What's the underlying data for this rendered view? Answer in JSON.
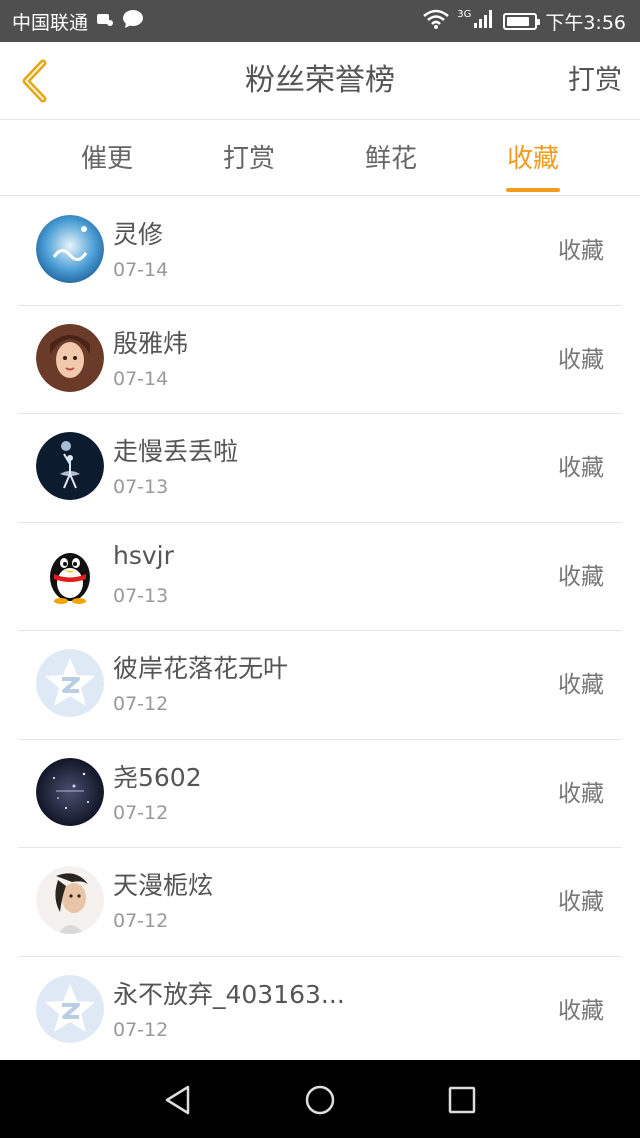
{
  "status_bar": {
    "carrier": "中国联通",
    "network": "3G",
    "time": "下午3:56",
    "battery_level": 0.85
  },
  "header": {
    "title": "粉丝荣誉榜",
    "right_action": "打赏"
  },
  "tabs": [
    {
      "label": "催更",
      "active": false
    },
    {
      "label": "打赏",
      "active": false
    },
    {
      "label": "鲜花",
      "active": false
    },
    {
      "label": "收藏",
      "active": true
    }
  ],
  "colors": {
    "accent": "#f29b1d",
    "status_bar_bg": "#4f4f4f"
  },
  "fans": [
    {
      "name": "灵修",
      "date": "07-14",
      "action": "收藏",
      "avatar": "blue-watercolor-avatar"
    },
    {
      "name": "殷雅炜",
      "date": "07-14",
      "action": "收藏",
      "avatar": "girl-portrait-avatar"
    },
    {
      "name": "走慢丢丢啦",
      "date": "07-13",
      "action": "收藏",
      "avatar": "dancer-night-avatar"
    },
    {
      "name": "hsvjr",
      "date": "07-13",
      "action": "收藏",
      "avatar": "penguin-avatar"
    },
    {
      "name": "彼岸花落花无叶",
      "date": "07-12",
      "action": "收藏",
      "avatar": "default-star-avatar"
    },
    {
      "name": "尧5602",
      "date": "07-12",
      "action": "收藏",
      "avatar": "galaxy-avatar"
    },
    {
      "name": "天漫栀炫",
      "date": "07-12",
      "action": "收藏",
      "avatar": "woman-profile-avatar"
    },
    {
      "name": "永不放弃_403163...",
      "date": "07-12",
      "action": "收藏",
      "avatar": "default-star-avatar"
    }
  ],
  "nav": {
    "back": "back-triangle-icon",
    "home": "home-circle-icon",
    "recents": "recents-square-icon"
  }
}
